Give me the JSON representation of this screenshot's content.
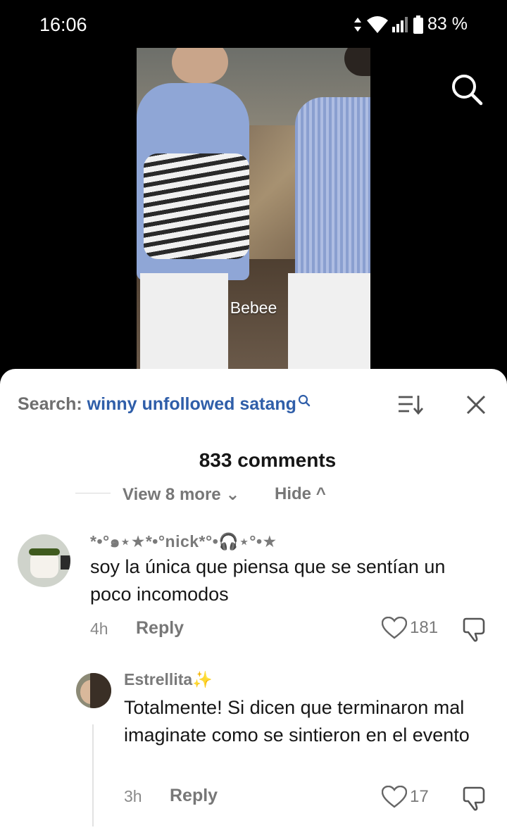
{
  "status_bar": {
    "time": "16:06",
    "battery_label": "83 %",
    "icons": [
      "data-arrows-icon",
      "wifi-icon",
      "signal-icon",
      "battery-icon"
    ]
  },
  "video": {
    "caption": "Bebee"
  },
  "sheet": {
    "search_prefix": "Search:",
    "search_term": "winny unfollowed satang",
    "comment_count": "833 comments",
    "view_more_label": "View 8 more",
    "hide_label": "Hide"
  },
  "comments": [
    {
      "username": "*•°๑⋆★*•°nick*°•🎧⋆°•★",
      "text": "soy la única que piensa que se sentían un poco incomodos",
      "time": "4h",
      "reply_label": "Reply",
      "likes": "181"
    },
    {
      "username": "Estrellita✨",
      "text": "Totalmente! Si dicen que terminaron mal imaginate como se sintieron en el evento",
      "time": "3h",
      "reply_label": "Reply",
      "likes": "17"
    }
  ],
  "colors": {
    "accent_link": "#2f5ea9",
    "sheet_bg": "#ffffff",
    "muted_text": "#7a7a7a"
  }
}
